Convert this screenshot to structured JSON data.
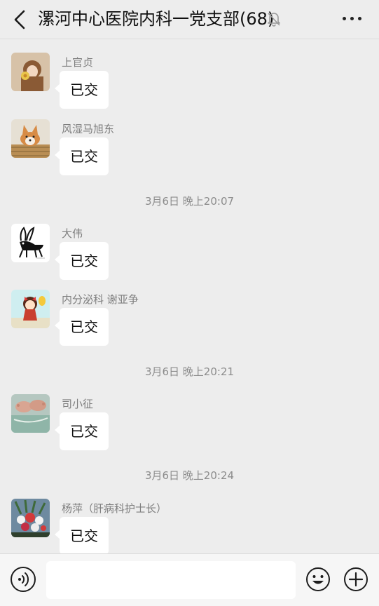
{
  "header": {
    "title": "漯河中心医院内科一党支部(68)",
    "icons": {
      "back": "chevron-left-icon",
      "mute": "bell-off-icon",
      "more": "more-horizontal-icon"
    }
  },
  "chat": {
    "messages": [
      {
        "sender": "上官贞",
        "text": "已交",
        "avatar": "avatar-girl-with-flower"
      },
      {
        "sender": "风湿马旭东",
        "text": "已交",
        "avatar": "avatar-corgi-in-basket"
      },
      {
        "timestamp": "3月6日 晚上20:07"
      },
      {
        "sender": "大伟",
        "text": "已交",
        "avatar": "avatar-donkey-drawing"
      },
      {
        "sender": "内分泌科 谢亚争",
        "text": "已交",
        "avatar": "avatar-cartoon-girl"
      },
      {
        "timestamp": "3月6日 晚上20:21"
      },
      {
        "sender": "司小征",
        "text": "已交",
        "avatar": "avatar-baby-feet"
      },
      {
        "timestamp": "3月6日 晚上20:24"
      },
      {
        "sender": "杨萍（肝病科护士长）",
        "text": "已交",
        "avatar": "avatar-flower-bouquet"
      }
    ]
  },
  "inputbar": {
    "input_value": "",
    "icons": {
      "voice": "voice-icon",
      "emoji": "emoji-icon",
      "plus": "plus-icon"
    }
  }
}
